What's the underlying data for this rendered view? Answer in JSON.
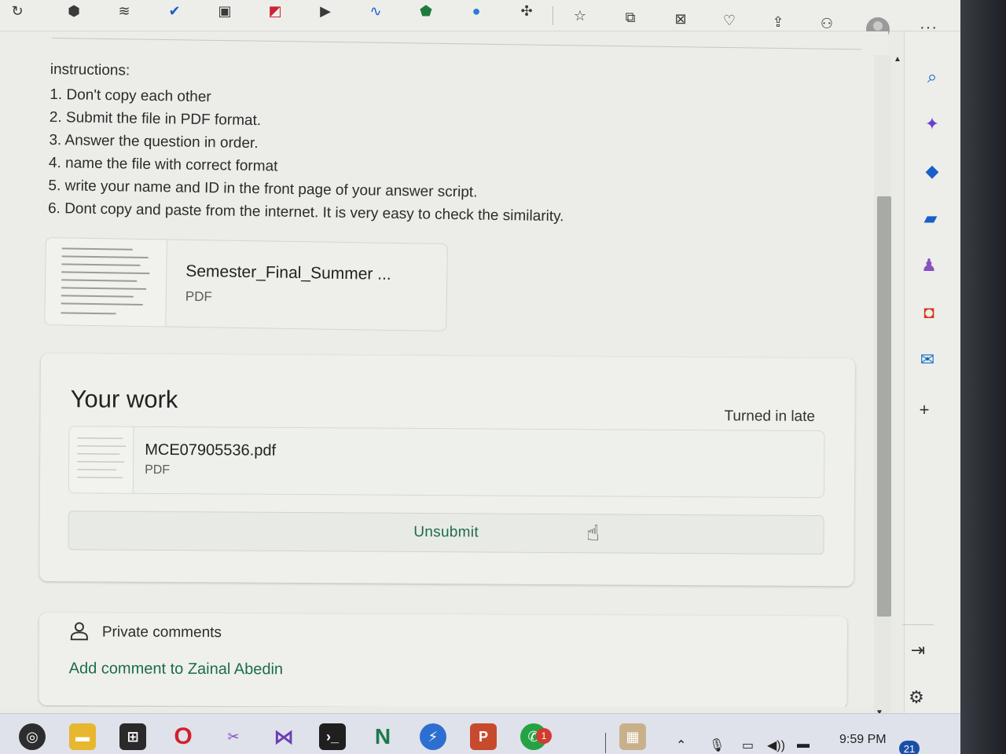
{
  "instructions": {
    "heading": "instructions:",
    "items": [
      "1. Don't copy each other",
      "2. Submit the file in PDF format.",
      "3. Answer the question in order.",
      "4. name the file with correct format",
      "5. write your name and ID in the front page of your answer script.",
      "6. Dont copy and paste from the internet. It is very easy to check the similarity."
    ]
  },
  "attachment": {
    "name": "Semester_Final_Summer ...",
    "type": "PDF"
  },
  "your_work": {
    "title": "Your work",
    "status": "Turned in late",
    "file": {
      "name": "MCE07905536.pdf",
      "type": "PDF"
    },
    "unsubmit_label": "Unsubmit"
  },
  "private_comments": {
    "title": "Private comments",
    "add_link": "Add comment to Zainal Abedin"
  },
  "taskbar": {
    "clock": "9:59 PM",
    "notification_count": "21",
    "whatsapp_badge": "1"
  },
  "colors": {
    "accent_green": "#1c6b4f",
    "page_bg": "#ecede8"
  }
}
